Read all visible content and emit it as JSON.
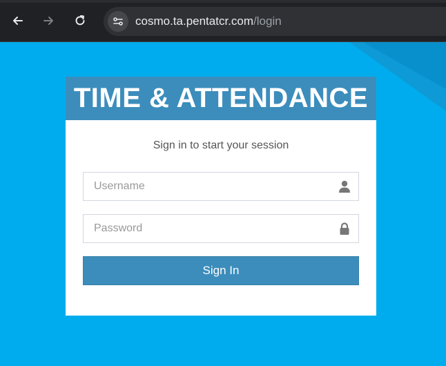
{
  "browser": {
    "url_host": "cosmo.ta.pentatcr.com",
    "url_path": "/login",
    "icons": [
      "back-arrow-icon",
      "forward-arrow-icon",
      "reload-icon",
      "site-settings-icon"
    ]
  },
  "login": {
    "title": "TIME & ATTENDANCE",
    "subtitle": "Sign in to start your session",
    "username_placeholder": "Username",
    "password_placeholder": "Password",
    "signin_label": "Sign In"
  },
  "colors": {
    "page_background": "#00aced",
    "accent": "#3c8dbc",
    "card": "#ffffff"
  }
}
